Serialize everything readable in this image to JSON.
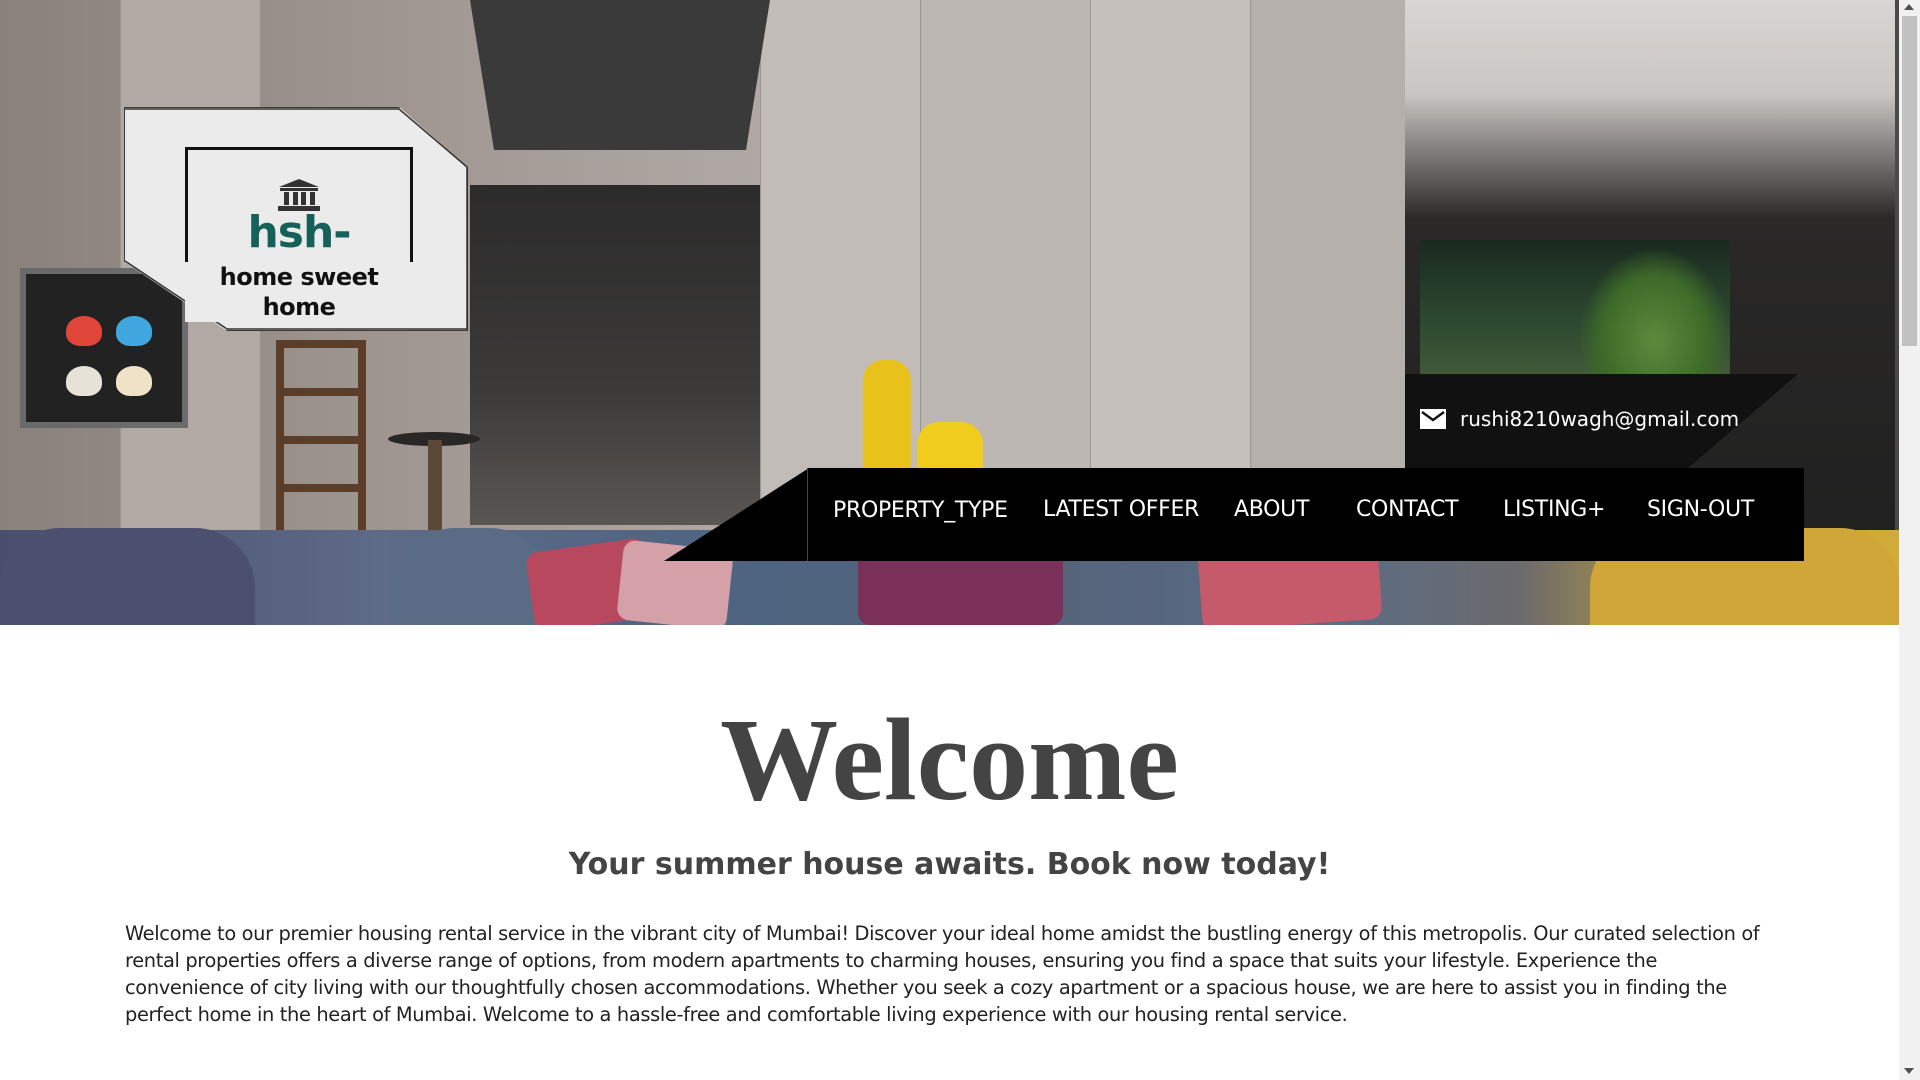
{
  "brand": {
    "name": "hsh-estate",
    "tagline": "home sweet home",
    "logo_icon": "bank-icon",
    "brand_color": "#15615a"
  },
  "contact": {
    "email": "rushi8210wagh@gmail.com",
    "email_icon": "mail-icon"
  },
  "nav": {
    "items": [
      {
        "label": "PROPERTY_TYPE"
      },
      {
        "label": "LATEST OFFER"
      },
      {
        "label": "ABOUT"
      },
      {
        "label": "CONTACT"
      },
      {
        "label": "LISTING+"
      },
      {
        "label": "SIGN-OUT"
      }
    ]
  },
  "main": {
    "heading": "Welcome",
    "subheading": "Your summer house awaits. Book now today!",
    "intro": "Welcome to our premier housing rental service in the vibrant city of Mumbai! Discover your ideal home amidst the bustling energy of this metropolis. Our curated selection of rental properties offers a diverse range of options, from modern apartments to charming houses, ensuring you find a space that suits your lifestyle. Experience the convenience of city living with our thoughtfully chosen accommodations. Whether you seek a cozy apartment or a spacious house, we are here to assist you in finding the perfect home in the heart of Mumbai. Welcome to a hassle-free and comfortable living experience with our housing rental service."
  },
  "colors": {
    "nav_background": "#000000",
    "heading_text": "#444444",
    "page_background": "#ffffff"
  }
}
